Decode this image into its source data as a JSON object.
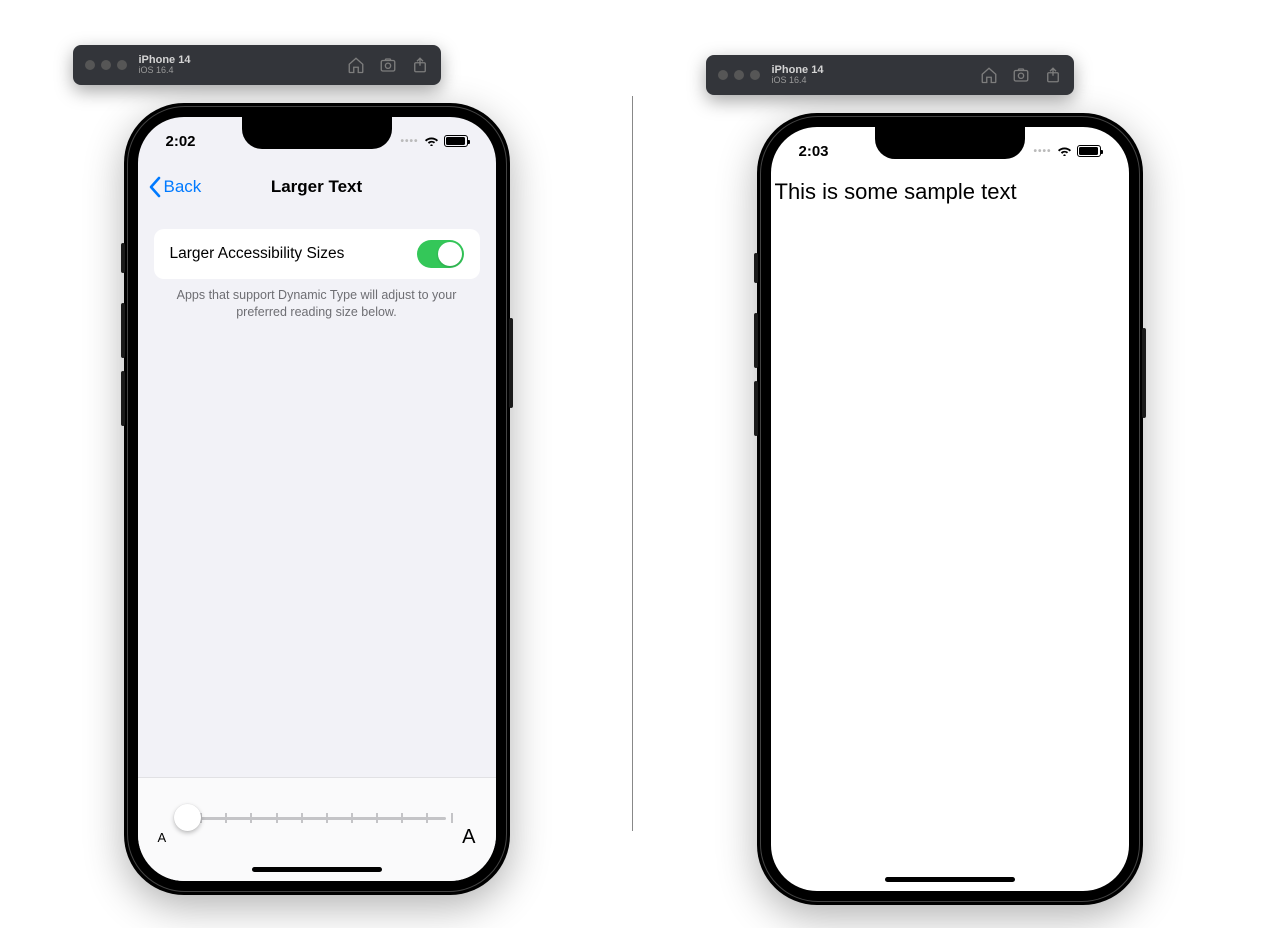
{
  "simulator": {
    "device": "iPhone 14",
    "os": "iOS 16.4",
    "icons": [
      "home-icon",
      "screenshot-icon",
      "export-icon"
    ]
  },
  "left": {
    "time": "2:02",
    "nav": {
      "back": "Back",
      "title": "Larger Text"
    },
    "row": {
      "label": "Larger Accessibility Sizes",
      "toggle_on": true
    },
    "helper": "Apps that support Dynamic Type will adjust to your preferred reading size below.",
    "slider": {
      "min_glyph": "A",
      "max_glyph": "A",
      "ticks": 12,
      "position": 0
    }
  },
  "right": {
    "time": "2:03",
    "sample_text": "This is some sample text"
  }
}
